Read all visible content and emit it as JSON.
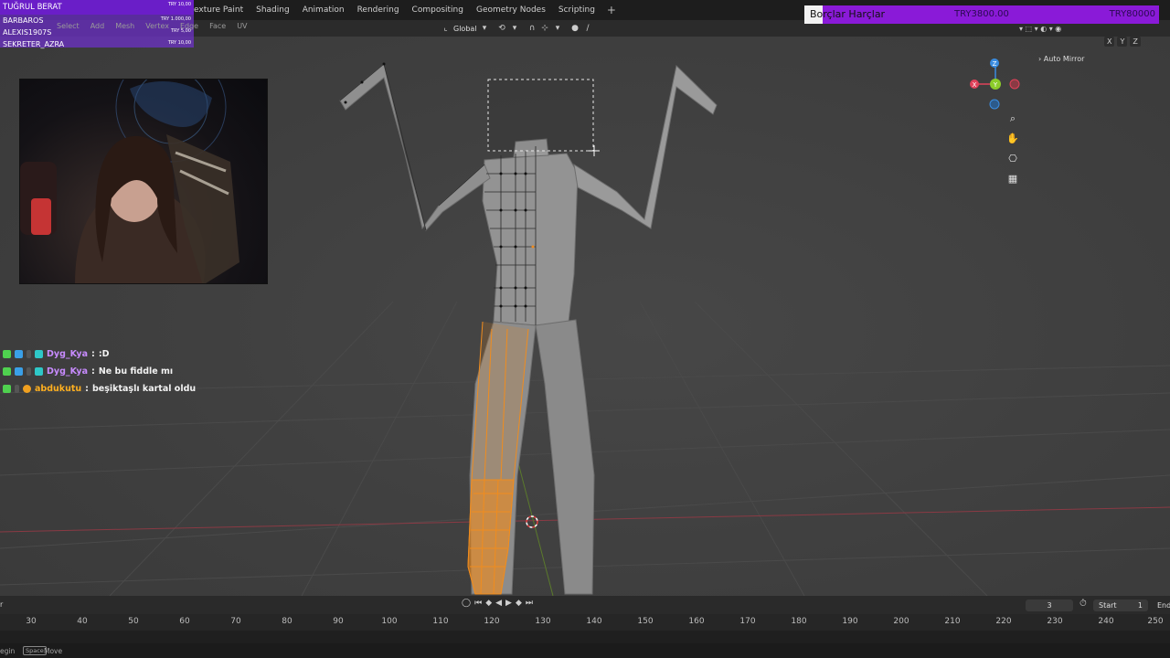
{
  "workspace_tabs": [
    "exture Paint",
    "Shading",
    "Animation",
    "Rendering",
    "Compositing",
    "Geometry Nodes",
    "Scripting",
    "+"
  ],
  "edit_menu": [
    "Select",
    "Add",
    "Mesh",
    "Vertex",
    "Edge",
    "Face",
    "UV"
  ],
  "header": {
    "orientation": "Global",
    "right_tool_icons": "▾ ⬚ ▾ ◐ ▾ ◉"
  },
  "axis_toggles": [
    "X",
    "Y",
    "Z"
  ],
  "donations": [
    {
      "name": "TUĞRUL BERAT",
      "amount": "TRY 10,00"
    },
    {
      "name": "BARBAROS",
      "amount": "TRY 1.000,00"
    },
    {
      "name": "ALEXIS1907S",
      "amount": "TRY 5,00"
    },
    {
      "name": "SEKRETER_AZRA",
      "amount": "TRY 10,00"
    }
  ],
  "goal": {
    "title": "Borçlar Harçlar",
    "current": "TRY3800.00",
    "target": "TRY80000"
  },
  "chat": [
    {
      "user": "Dyg_Kya",
      "user_color": "#c88bff",
      "message": ":D"
    },
    {
      "user": "Dyg_Kya",
      "user_color": "#c88bff",
      "message": "Ne bu fiddle mı"
    },
    {
      "user": "abdukutu",
      "user_color": "#ffb020",
      "message": "beşiktaşlı kartal oldu"
    }
  ],
  "overlay": {
    "auto_mirror": "Auto Mirror"
  },
  "gizmo": {
    "x": "X",
    "y": "Y",
    "z": "Z"
  },
  "timeline": {
    "left_label": "r",
    "current_frame": "3",
    "start_label": "Start",
    "start_value": "1",
    "end_label": "End",
    "ruler": [
      "30",
      "40",
      "50",
      "60",
      "70",
      "80",
      "90",
      "100",
      "110",
      "120",
      "130",
      "140",
      "150",
      "160",
      "170",
      "180",
      "190",
      "200",
      "210",
      "220",
      "230",
      "240",
      "250"
    ]
  },
  "status": {
    "begin": "egin",
    "key": "Space",
    "action": "Move"
  },
  "colors": {
    "selection_orange": "#f08c1e",
    "donation_purple": "#6a1ec8",
    "goal_purple": "#8a1ad8",
    "x_axis": "#e0425a",
    "y_axis": "#8ccc2a",
    "z_axis": "#3a8ce0"
  }
}
